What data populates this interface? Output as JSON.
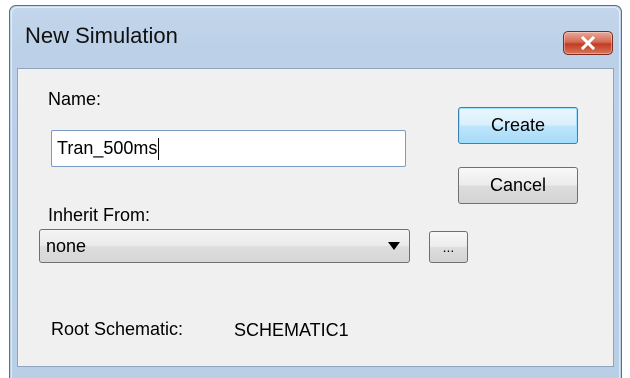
{
  "window": {
    "title": "New Simulation"
  },
  "form": {
    "name_label": "Name:",
    "name_value": "Tran_500ms",
    "inherit_label": "Inherit From:",
    "inherit_value": "none",
    "browse_label": "...",
    "root_label": "Root Schematic:",
    "root_value": "SCHEMATIC1"
  },
  "buttons": {
    "create_label": "Create",
    "cancel_label": "Cancel"
  },
  "icons": {
    "close": "close-icon",
    "dropdown": "chevron-down-icon"
  },
  "colors": {
    "close_button": "#c23c22",
    "default_button_border": "#3c7fb1",
    "title_bar": "#bcd1e8"
  }
}
